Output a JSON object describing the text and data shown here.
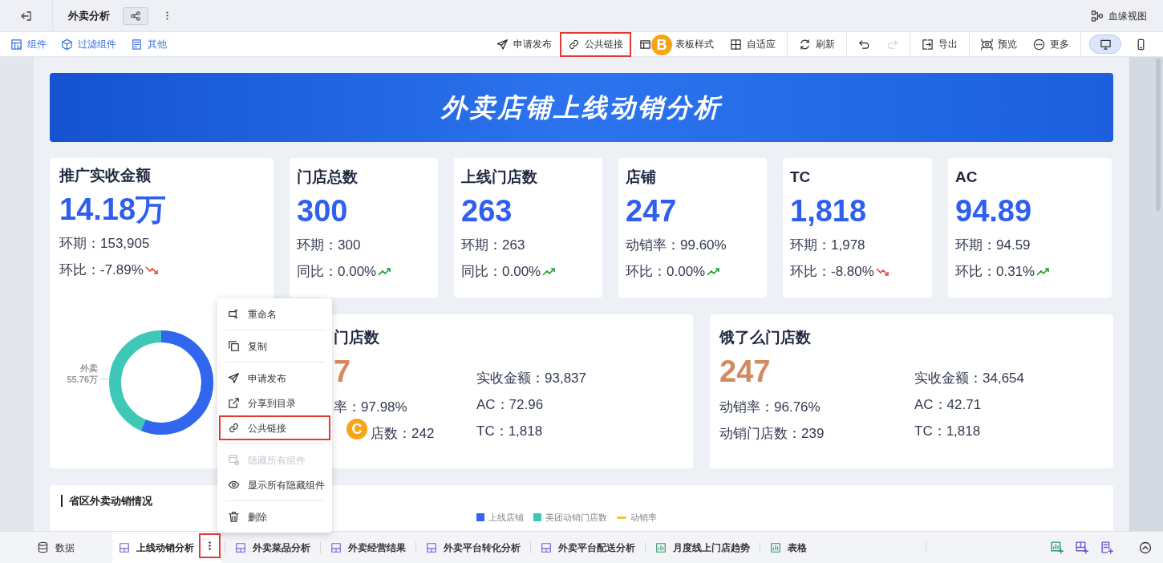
{
  "topbar": {
    "title": "外卖分析",
    "lineage": "血缘视图"
  },
  "toolbar": {
    "left": [
      {
        "kind": "widget",
        "label": "组件"
      },
      {
        "kind": "filter",
        "label": "过滤组件"
      },
      {
        "kind": "other",
        "label": "其他"
      }
    ],
    "groups": [
      {
        "items": [
          {
            "kind": "publish",
            "label": "申请发布",
            "highlighted": false,
            "disabled": false
          },
          {
            "kind": "link",
            "label": "公共链接",
            "highlighted": true,
            "disabled": false
          },
          {
            "kind": "style",
            "label": "表板样式",
            "highlighted": false,
            "disabled": false
          },
          {
            "kind": "fit",
            "label": "自适应",
            "highlighted": false,
            "disabled": false
          }
        ]
      },
      {
        "items": [
          {
            "kind": "refresh",
            "label": "刷新",
            "highlighted": false,
            "disabled": false
          }
        ]
      },
      {
        "items": [
          {
            "kind": "undo",
            "highlighted": false,
            "disabled": false
          },
          {
            "kind": "redo",
            "highlighted": false,
            "disabled": true
          }
        ]
      },
      {
        "items": [
          {
            "kind": "export",
            "label": "导出",
            "highlighted": false,
            "disabled": false
          }
        ]
      },
      {
        "items": [
          {
            "kind": "preview",
            "label": "预览",
            "highlighted": false,
            "disabled": false
          },
          {
            "kind": "more",
            "label": "更多",
            "highlighted": false,
            "disabled": false
          }
        ]
      }
    ],
    "views": [
      {
        "kind": "desktop",
        "selected": true
      },
      {
        "kind": "mobile",
        "selected": false
      }
    ]
  },
  "banner": {
    "title": "外卖店铺上线动销分析"
  },
  "kpis": [
    {
      "title": "推广实收金额",
      "value": "14.18万",
      "lines": [
        {
          "text": "环期：153,905",
          "kind": "plain"
        },
        {
          "text": "环比：-7.89%",
          "kind": "falling"
        }
      ],
      "donut": {
        "label": "外卖",
        "value": "55.76万"
      }
    },
    {
      "title": "门店总数",
      "value": "300",
      "lines": [
        {
          "text": "环期：300",
          "kind": "plain"
        },
        {
          "text": "同比：0.00%",
          "kind": "rising"
        }
      ]
    },
    {
      "title": "上线门店数",
      "value": "263",
      "lines": [
        {
          "text": "环期：263",
          "kind": "plain"
        },
        {
          "text": "同比：0.00%",
          "kind": "rising"
        }
      ]
    },
    {
      "title": "店铺",
      "value": "247",
      "lines": [
        {
          "text": "动销率：99.60%",
          "kind": "plain"
        },
        {
          "text": "环比：0.00%",
          "kind": "rising"
        }
      ]
    },
    {
      "title": "TC",
      "value": "1,818",
      "lines": [
        {
          "text": "环期：1,978",
          "kind": "plain"
        },
        {
          "text": "环比：-8.80%",
          "kind": "falling"
        }
      ]
    },
    {
      "title": "AC",
      "value": "94.89",
      "lines": [
        {
          "text": "环期：94.59",
          "kind": "plain"
        },
        {
          "text": "环比：0.31%",
          "kind": "rising"
        }
      ]
    }
  ],
  "platform_cards": [
    {
      "title": "门店数",
      "value": "7",
      "left": [
        "率：97.98%",
        "店数：242"
      ],
      "right": [
        "实收金额：93,837",
        "AC：72.96",
        "TC：1,818"
      ]
    },
    {
      "title": "饿了么门店数",
      "value": "247",
      "left": [
        "动销率：96.76%",
        "动销门店数：239"
      ],
      "right": [
        "实收金额：34,654",
        "AC：42.71",
        "TC：1,818"
      ]
    }
  ],
  "section": {
    "title": "省区外卖动销情况",
    "legend": [
      {
        "kind": "bar",
        "label": "上线店铺",
        "color": "#3366ee"
      },
      {
        "kind": "bar",
        "label": "美团动销门店数",
        "color": "#3cc8b4"
      },
      {
        "kind": "line",
        "label": "动销率",
        "color": "#f7c244"
      }
    ]
  },
  "context_menu": {
    "groups": [
      {
        "items": [
          {
            "kind": "rename",
            "label": "重命名",
            "highlighted": false,
            "disabled": false
          }
        ]
      },
      {
        "items": [
          {
            "kind": "copy",
            "label": "复制",
            "highlighted": false,
            "disabled": false
          }
        ]
      },
      {
        "items": [
          {
            "kind": "publish",
            "label": "申请发布",
            "highlighted": false,
            "disabled": false
          },
          {
            "kind": "share",
            "label": "分享到目录",
            "highlighted": false,
            "disabled": false
          },
          {
            "kind": "link",
            "label": "公共链接",
            "highlighted": true,
            "disabled": false
          }
        ]
      },
      {
        "items": [
          {
            "kind": "hide",
            "label": "隐藏所有组件",
            "highlighted": false,
            "disabled": true
          },
          {
            "kind": "show",
            "label": "显示所有隐藏组件",
            "highlighted": false,
            "disabled": false
          }
        ]
      },
      {
        "items": [
          {
            "kind": "delete",
            "label": "删除",
            "highlighted": false,
            "disabled": false
          }
        ]
      }
    ]
  },
  "tabbar": {
    "data_label": "数据",
    "menu_highlighted": true,
    "tabs": [
      {
        "kind": "dashboard",
        "label": "上线动销分析",
        "selected": true
      },
      {
        "kind": "dashboard",
        "label": "外卖菜品分析",
        "selected": false
      },
      {
        "kind": "dashboard",
        "label": "外卖经营结果",
        "selected": false
      },
      {
        "kind": "dashboard",
        "label": "外卖平台转化分析",
        "selected": false
      },
      {
        "kind": "dashboard",
        "label": "外卖平台配送分析",
        "selected": false
      },
      {
        "kind": "chart",
        "label": "月度线上门店趋势",
        "selected": false
      },
      {
        "kind": "chart",
        "label": "表格",
        "selected": false
      }
    ]
  },
  "callouts": [
    {
      "label": "B"
    },
    {
      "label": "C"
    }
  ]
}
